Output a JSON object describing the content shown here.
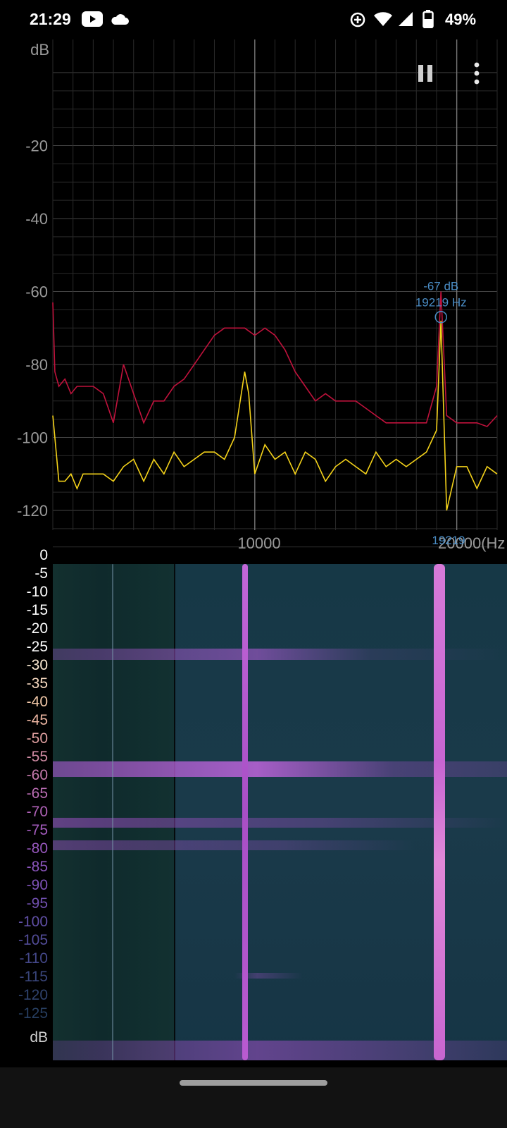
{
  "status_bar": {
    "time": "21:29",
    "left_icons": [
      "youtube-icon",
      "cloud-icon"
    ],
    "right_icons": [
      "data-saver-icon",
      "wifi-icon",
      "signal-icon",
      "battery-icon"
    ],
    "battery": "49%"
  },
  "toolbar": {
    "pause_icon": "pause-icon",
    "menu_icon": "more-vert-icon"
  },
  "spectrum": {
    "y_unit": "dB",
    "y_ticks": [
      "-20",
      "-40",
      "-60",
      "-80",
      "-100",
      "-120"
    ],
    "x_tick": "10000",
    "x_unit_label": "20000(Hz",
    "peak_db": "-67 dB",
    "peak_hz": "19219 Hz",
    "peak_marker_label": "19219",
    "colors": {
      "max_hold": "#c0123c",
      "live": "#f4d21a",
      "peak": "#4a8cc4",
      "grid": "#3a3a3a"
    }
  },
  "chart_data": {
    "type": "line",
    "title": "",
    "xlabel": "Hz",
    "ylabel": "dB",
    "xlim": [
      0,
      22000
    ],
    "ylim": [
      -135,
      0
    ],
    "grid": true,
    "series": [
      {
        "x": [
          0,
          100,
          300,
          600,
          900,
          1200,
          1500,
          2000,
          2500,
          3000,
          3500,
          4000,
          4500,
          5000,
          5500,
          6000,
          6500,
          7000,
          7500,
          8000,
          8500,
          9000,
          9500,
          10000,
          10500,
          11000,
          11500,
          12000,
          12500,
          13000,
          13500,
          14000,
          14500,
          15000,
          15500,
          16000,
          16500,
          17000,
          17500,
          18000,
          18500,
          19000,
          19219,
          19500,
          20000,
          20500,
          21000,
          21500,
          22000
        ],
        "y": [
          -63,
          -82,
          -86,
          -84,
          -88,
          -86,
          -86,
          -86,
          -88,
          -96,
          -80,
          -88,
          -96,
          -90,
          -90,
          -86,
          -84,
          -80,
          -76,
          -72,
          -70,
          -70,
          -70,
          -72,
          -70,
          -72,
          -76,
          -82,
          -86,
          -90,
          -88,
          -90,
          -90,
          -90,
          -92,
          -94,
          -96,
          -96,
          -96,
          -96,
          -96,
          -86,
          -60,
          -94,
          -96,
          -96,
          -96,
          -97,
          -94
        ]
      },
      {
        "x": [
          0,
          100,
          300,
          600,
          900,
          1200,
          1500,
          2000,
          2500,
          3000,
          3500,
          4000,
          4500,
          5000,
          5500,
          6000,
          6500,
          7000,
          7500,
          8000,
          8500,
          9000,
          9500,
          9700,
          10000,
          10500,
          11000,
          11500,
          12000,
          12500,
          13000,
          13500,
          14000,
          14500,
          15000,
          15500,
          16000,
          16500,
          17000,
          17500,
          18000,
          18500,
          19000,
          19219,
          19500,
          20000,
          20500,
          21000,
          21500,
          22000
        ],
        "y": [
          -94,
          -100,
          -112,
          -112,
          -110,
          -114,
          -110,
          -110,
          -110,
          -112,
          -108,
          -106,
          -112,
          -106,
          -110,
          -104,
          -108,
          -106,
          -104,
          -104,
          -106,
          -100,
          -82,
          -88,
          -110,
          -102,
          -106,
          -104,
          -110,
          -104,
          -106,
          -112,
          -108,
          -106,
          -108,
          -110,
          -104,
          -108,
          -106,
          -108,
          -106,
          -104,
          -98,
          -68,
          -120,
          -108,
          -108,
          -114,
          -108,
          -110
        ]
      }
    ]
  },
  "spectrogram": {
    "level_labels": [
      "0",
      "-5",
      "-10",
      "-15",
      "-20",
      "-25",
      "-30",
      "-35",
      "-40",
      "-45",
      "-50",
      "-55",
      "-60",
      "-65",
      "-70",
      "-75",
      "-80",
      "-85",
      "-90",
      "-95",
      "-100",
      "-105",
      "-110",
      "-115",
      "-120",
      "-125"
    ],
    "unit": "dB"
  }
}
